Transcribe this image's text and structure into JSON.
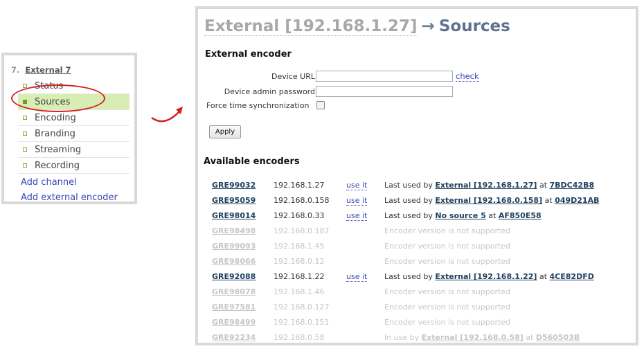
{
  "sidebar": {
    "number": "7.",
    "channel_name": "External 7",
    "items": [
      {
        "label": "Status"
      },
      {
        "label": "Sources"
      },
      {
        "label": "Encoding"
      },
      {
        "label": "Branding"
      },
      {
        "label": "Streaming"
      },
      {
        "label": "Recording"
      }
    ],
    "active_item": "Sources",
    "add_channel": "Add channel",
    "add_external_encoder": "Add external encoder"
  },
  "breadcrumb": {
    "parent": "External [192.168.1.27]",
    "separator": "→",
    "current": "Sources"
  },
  "external_encoder": {
    "heading": "External encoder",
    "device_url_label": "Device URL",
    "device_url_value": "",
    "check_label": "check",
    "admin_password_label": "Device admin password",
    "admin_password_value": "",
    "time_sync_label": "Force time synchronization",
    "time_sync_checked": false,
    "apply_label": "Apply"
  },
  "available_encoders": {
    "heading": "Available encoders",
    "rows": [
      {
        "id": "GRE99032",
        "ip": "192.168.1.27",
        "use": "use it",
        "status": "Last used by",
        "target": "External [192.168.1.27]",
        "at": "at",
        "serial": "7BDC42B8",
        "disabled": false
      },
      {
        "id": "GRE95059",
        "ip": "192.168.0.158",
        "use": "use it",
        "status": "Last used by",
        "target": "External [192.168.0.158]",
        "at": "at",
        "serial": "049D21AB",
        "disabled": false
      },
      {
        "id": "GRE98014",
        "ip": "192.168.0.33",
        "use": "use it",
        "status": "Last used by",
        "target": "No source 5",
        "at": "at",
        "serial": "AF850E58",
        "disabled": false
      },
      {
        "id": "GRE98498",
        "ip": "192.168.0.187",
        "use": "",
        "status": "Encoder version is not supported",
        "target": "",
        "at": "",
        "serial": "",
        "disabled": true
      },
      {
        "id": "GRE99093",
        "ip": "192.168.1.45",
        "use": "",
        "status": "Encoder version is not supported",
        "target": "",
        "at": "",
        "serial": "",
        "disabled": true
      },
      {
        "id": "GRE98066",
        "ip": "192.168.0.12",
        "use": "",
        "status": "Encoder version is not supported",
        "target": "",
        "at": "",
        "serial": "",
        "disabled": true
      },
      {
        "id": "GRE92088",
        "ip": "192.168.1.22",
        "use": "use it",
        "status": "Last used by",
        "target": "External [192.168.1.22]",
        "at": "at",
        "serial": "4CE82DFD",
        "disabled": false
      },
      {
        "id": "GRE98078",
        "ip": "192.168.1.46",
        "use": "",
        "status": "Encoder version is not supported",
        "target": "",
        "at": "",
        "serial": "",
        "disabled": true
      },
      {
        "id": "GRE97581",
        "ip": "192.168.0.127",
        "use": "",
        "status": "Encoder version is not supported",
        "target": "",
        "at": "",
        "serial": "",
        "disabled": true
      },
      {
        "id": "GRE98499",
        "ip": "192.168.0.151",
        "use": "",
        "status": "Encoder version is not supported",
        "target": "",
        "at": "",
        "serial": "",
        "disabled": true
      },
      {
        "id": "GRE92234",
        "ip": "192.168.0.58",
        "use": "",
        "status": "In use by",
        "target": "External [192.168.0.58]",
        "at": "at",
        "serial": "D560503B",
        "disabled": true
      }
    ]
  },
  "colors": {
    "active_item_bg": "#d7edb4",
    "link_blue": "#3a48b8",
    "annotation_red": "#d42020",
    "title_gray": "#a8a8a8",
    "title_blue": "#5f7290"
  }
}
